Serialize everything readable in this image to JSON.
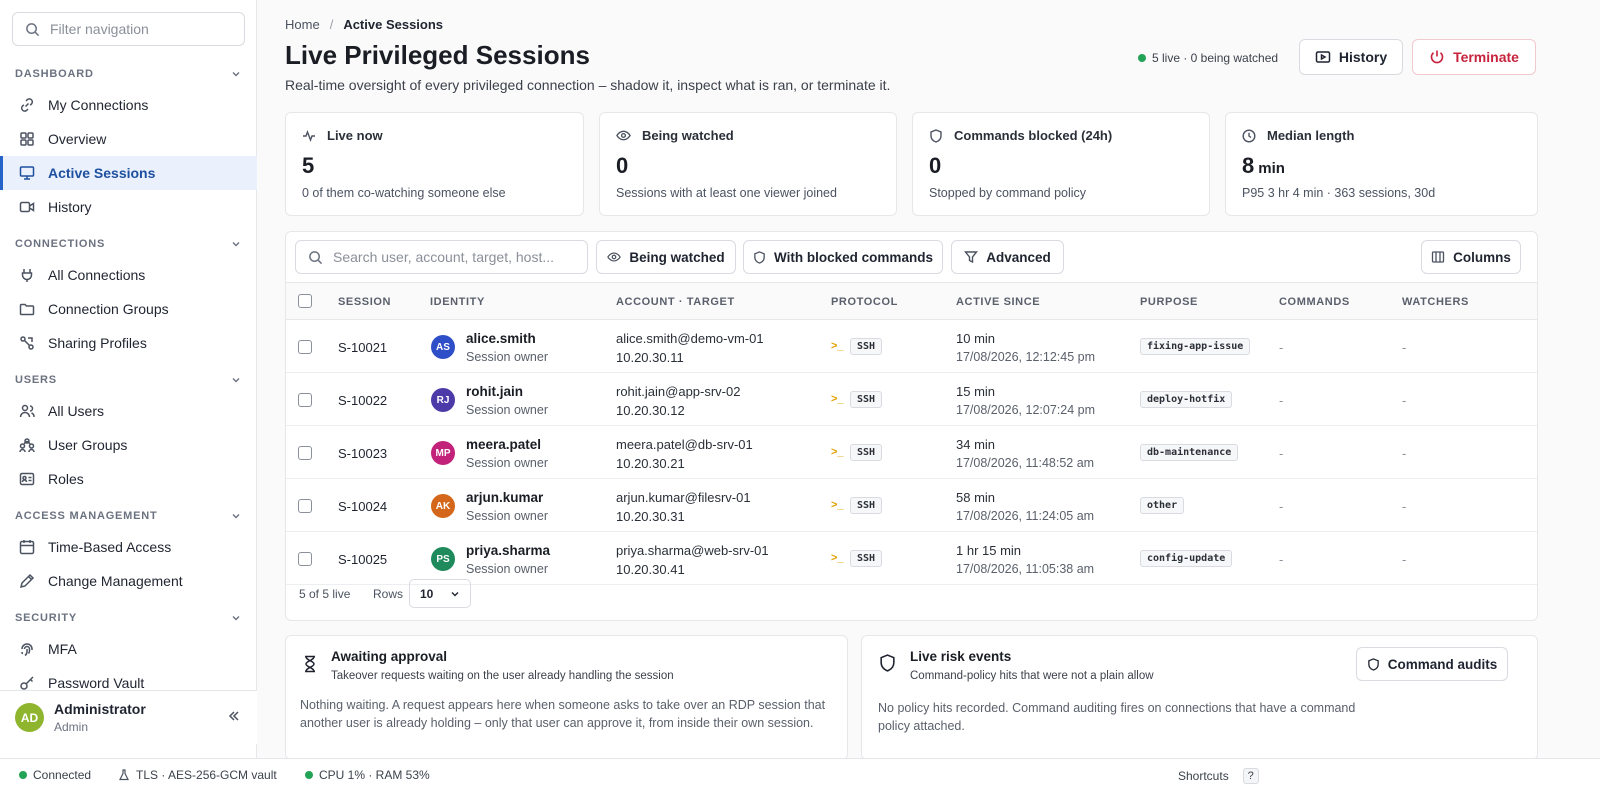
{
  "sidebar": {
    "filter_placeholder": "Filter navigation",
    "sections": {
      "dashboard": "DASHBOARD",
      "connections": "CONNECTIONS",
      "users": "USERS",
      "access": "ACCESS MANAGEMENT",
      "security": "SECURITY"
    },
    "items": {
      "my_connections": "My Connections",
      "overview": "Overview",
      "active_sessions": "Active Sessions",
      "history": "History",
      "all_connections": "All Connections",
      "connection_groups": "Connection Groups",
      "sharing_profiles": "Sharing Profiles",
      "all_users": "All Users",
      "user_groups": "User Groups",
      "roles": "Roles",
      "time_based_access": "Time-Based Access",
      "change_management": "Change Management",
      "mfa": "MFA",
      "password_vault": "Password Vault"
    },
    "user": {
      "initials": "AD",
      "name": "Administrator",
      "role": "Admin"
    }
  },
  "header": {
    "breadcrumb_home": "Home",
    "breadcrumb_sep": "/",
    "breadcrumb_current": "Active Sessions",
    "title": "Live Privileged Sessions",
    "subtitle": "Real-time oversight of every privileged connection – shadow it, inspect what is ran, or terminate it.",
    "live_status": "5 live · 0 being watched",
    "history_button": "History",
    "terminate_button": "Terminate"
  },
  "stats": [
    {
      "label": "Live now",
      "value": "5",
      "unit": "",
      "note": "0 of them co-watching someone else",
      "icon": "activity-icon"
    },
    {
      "label": "Being watched",
      "value": "0",
      "unit": "",
      "note": "Sessions with at least one viewer joined",
      "icon": "eye-icon"
    },
    {
      "label": "Commands blocked (24h)",
      "value": "0",
      "unit": "",
      "note": "Stopped by command policy",
      "icon": "shield-icon"
    },
    {
      "label": "Median length",
      "value": "8",
      "unit": "min",
      "note": "P95 3 hr 4 min · 363 sessions, 30d",
      "icon": "clock-icon"
    }
  ],
  "toolbar": {
    "search_placeholder": "Search user, account, target, host...",
    "being_watched": "Being watched",
    "with_blocked": "With blocked commands",
    "advanced": "Advanced",
    "columns": "Columns"
  },
  "table": {
    "headers": [
      "SESSION",
      "IDENTITY",
      "ACCOUNT · TARGET",
      "PROTOCOL",
      "ACTIVE SINCE",
      "PURPOSE",
      "COMMANDS",
      "WATCHERS"
    ],
    "rows": [
      {
        "session": "S-10021",
        "initials": "AS",
        "avatar_color": "#2f4fc8",
        "name": "alice.smith",
        "role": "Session owner",
        "account": "alice.smith@demo-vm-01",
        "ip": "10.20.30.11",
        "protocol": "SSH",
        "since": "10 min",
        "since_date": "17/08/2026, 12:12:45 pm",
        "purpose": "fixing-app-issue",
        "commands": "-",
        "watchers": "-"
      },
      {
        "session": "S-10022",
        "initials": "RJ",
        "avatar_color": "#4b3aa8",
        "name": "rohit.jain",
        "role": "Session owner",
        "account": "rohit.jain@app-srv-02",
        "ip": "10.20.30.12",
        "protocol": "SSH",
        "since": "15 min",
        "since_date": "17/08/2026, 12:07:24 pm",
        "purpose": "deploy-hotfix",
        "commands": "-",
        "watchers": "-"
      },
      {
        "session": "S-10023",
        "initials": "MP",
        "avatar_color": "#c2227a",
        "name": "meera.patel",
        "role": "Session owner",
        "account": "meera.patel@db-srv-01",
        "ip": "10.20.30.21",
        "protocol": "SSH",
        "since": "34 min",
        "since_date": "17/08/2026, 11:48:52 am",
        "purpose": "db-maintenance",
        "commands": "-",
        "watchers": "-"
      },
      {
        "session": "S-10024",
        "initials": "AK",
        "avatar_color": "#d4671b",
        "name": "arjun.kumar",
        "role": "Session owner",
        "account": "arjun.kumar@filesrv-01",
        "ip": "10.20.30.31",
        "protocol": "SSH",
        "since": "58 min",
        "since_date": "17/08/2026, 11:24:05 am",
        "purpose": "other",
        "commands": "-",
        "watchers": "-"
      },
      {
        "session": "S-10025",
        "initials": "PS",
        "avatar_color": "#1f8a5c",
        "name": "priya.sharma",
        "role": "Session owner",
        "account": "priya.sharma@web-srv-01",
        "ip": "10.20.30.41",
        "protocol": "SSH",
        "since": "1 hr 15 min",
        "since_date": "17/08/2026, 11:05:38 am",
        "purpose": "config-update",
        "commands": "-",
        "watchers": "-"
      }
    ],
    "footer_count": "5 of 5 live",
    "rows_label": "Rows",
    "rows_value": "10"
  },
  "panels": {
    "approval": {
      "title": "Awaiting approval",
      "subtitle": "Takeover requests waiting on the user already handling the session",
      "body": "Nothing waiting. A request appears here when someone asks to take over an RDP session that another user is already holding – only that user can approve it, from inside their own session."
    },
    "risk": {
      "title": "Live risk events",
      "subtitle": "Command-policy hits that were not a plain allow",
      "body": "No policy hits recorded. Command auditing fires on connections that have a command policy attached.",
      "button": "Command audits"
    }
  },
  "statusbar": {
    "connected": "Connected",
    "tls": "TLS · AES-256-GCM vault",
    "cpu": "CPU 1% · RAM 53%",
    "shortcuts": "Shortcuts",
    "shortcut_key": "?"
  },
  "colors": {
    "accent": "#2563c9",
    "danger": "#c8233d",
    "live": "#22a355"
  }
}
